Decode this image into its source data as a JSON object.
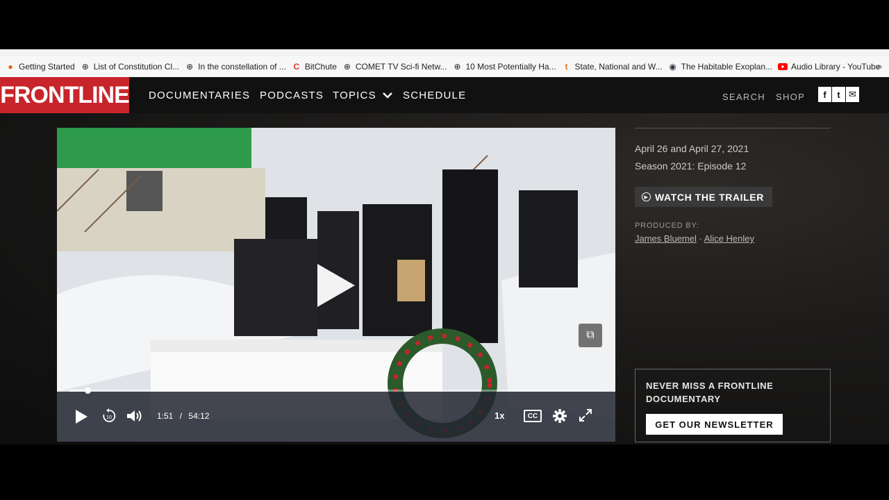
{
  "bookmarks": [
    {
      "label": "Getting Started",
      "icon": "firefox-icon"
    },
    {
      "label": "List of Constitution Cl...",
      "icon": "globe-icon"
    },
    {
      "label": "In the constellation of ...",
      "icon": "globe-icon"
    },
    {
      "label": "BitChute",
      "icon": "bitchute-icon"
    },
    {
      "label": "COMET TV Sci-fi Netw...",
      "icon": "globe-icon"
    },
    {
      "label": "10 Most Potentially Ha...",
      "icon": "globe-icon"
    },
    {
      "label": "State, National and W...",
      "icon": "t-icon"
    },
    {
      "label": "The Habitable Exoplan...",
      "icon": "planet-icon"
    },
    {
      "label": "Audio Library - YouTube",
      "icon": "youtube-icon"
    }
  ],
  "nav": {
    "logo": "FRONTLINE",
    "documentaries": "DOCUMENTARIES",
    "podcasts": "PODCASTS",
    "topics": "TOPICS",
    "schedule": "SCHEDULE",
    "search": "SEARCH",
    "shop": "SHOP",
    "social": [
      "f",
      "t",
      "✉"
    ]
  },
  "player": {
    "current_time": "1:51",
    "separator": "/",
    "duration": "54:12",
    "progress_fraction": 0.034,
    "speed": "1x",
    "cc": "CC"
  },
  "info": {
    "air_dates": "April 26 and April 27, 2021",
    "season": "Season 2021: Episode 12",
    "trailer_label": "WATCH THE TRAILER",
    "produced_by_label": "PRODUCED BY:",
    "producer_1": "James Bluemel",
    "producer_sep": " · ",
    "producer_2": "Alice Henley"
  },
  "newsletter": {
    "title": "NEVER MISS A FRONTLINE DOCUMENTARY",
    "button": "GET OUR NEWSLETTER"
  },
  "colors": {
    "brand_red": "#c8242b"
  }
}
